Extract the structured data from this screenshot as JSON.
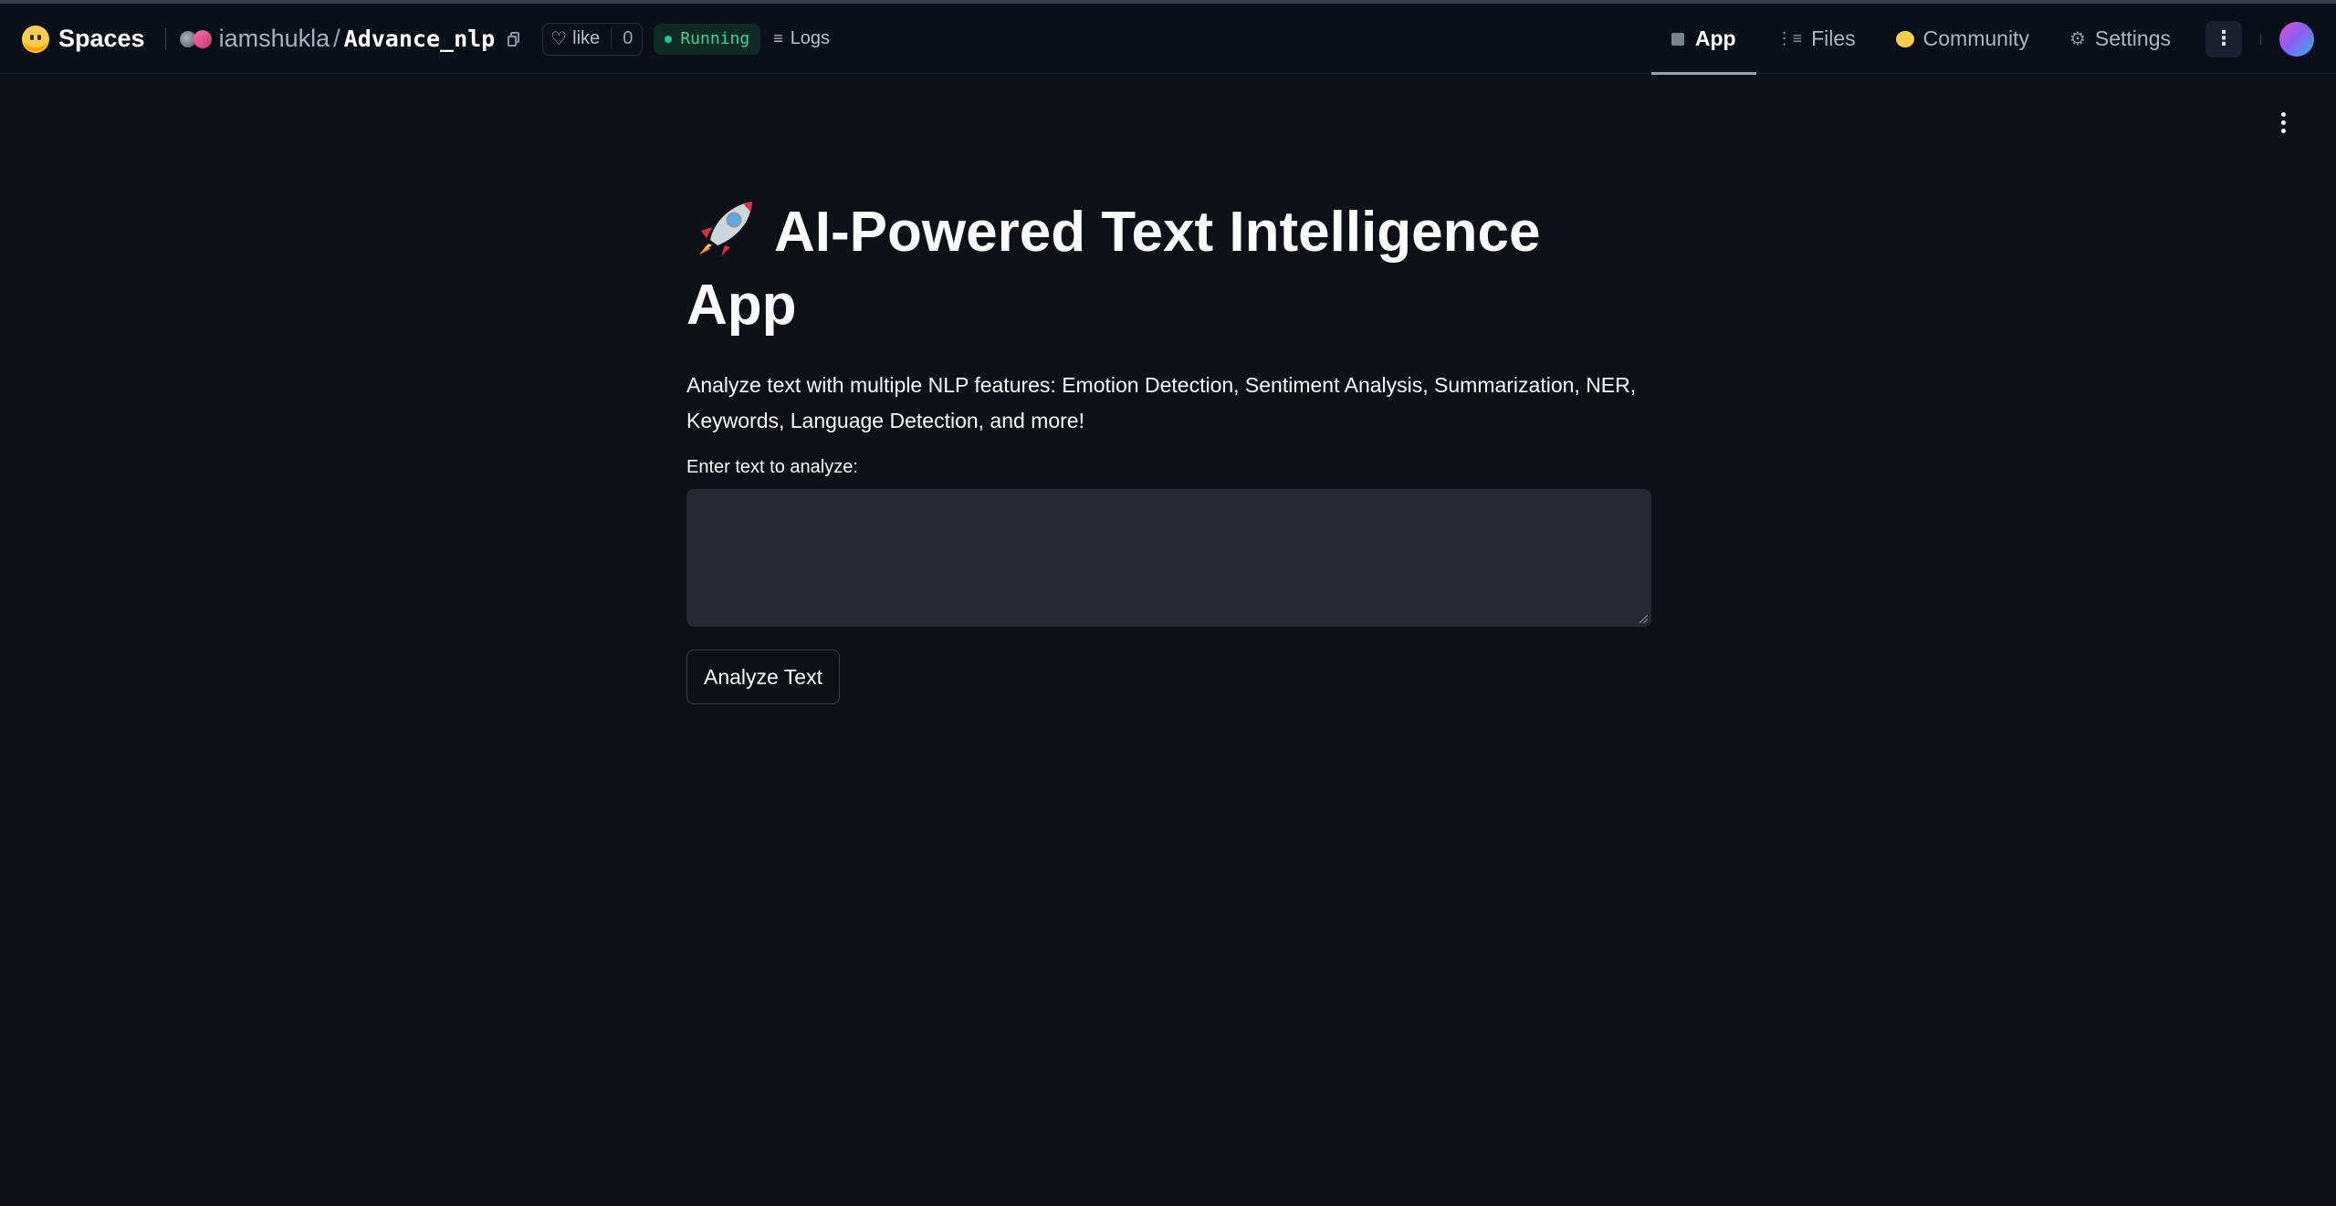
{
  "header": {
    "spaces_label": "Spaces",
    "owner": "iamshukla",
    "separator": "/",
    "repo": "Advance_nlp",
    "like_label": "like",
    "like_count": "0",
    "status": "Running",
    "logs_label": "Logs",
    "tabs": [
      {
        "label": "App",
        "icon": "cube-icon",
        "active": true
      },
      {
        "label": "Files",
        "icon": "files-icon",
        "active": false
      },
      {
        "label": "Community",
        "icon": "community-icon",
        "active": false
      },
      {
        "label": "Settings",
        "icon": "gear-icon",
        "active": false
      }
    ],
    "colors": {
      "status_green": "#22c58b",
      "background": "#0b0f19"
    }
  },
  "main": {
    "title": "AI-Powered Text Intelligence App",
    "title_icon": "rocket-icon",
    "description": "Analyze text with multiple NLP features: Emotion Detection, Sentiment Analysis, Summarization, NER, Keywords, Language Detection, and more!",
    "input_label": "Enter text to analyze:",
    "input_value": "",
    "button_label": "Analyze Text"
  },
  "colors": {
    "page_background": "#0e1117",
    "input_background": "#262730",
    "text": "#fafafa"
  }
}
